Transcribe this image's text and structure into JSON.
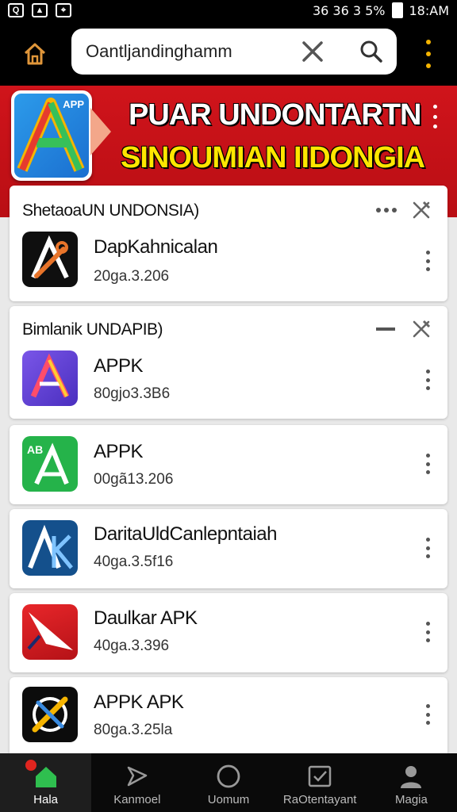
{
  "status_bar": {
    "left_icons": [
      "photo-icon",
      "image-icon",
      "app-icon"
    ],
    "right_text": "36  36 3 5%",
    "time": "18:AM"
  },
  "top_bar": {
    "search_value": "Oantljandinghamm"
  },
  "banner": {
    "logo_label": "APP",
    "title_line1": "PUAR UNDONTARTN",
    "title_line2": "SINOUMIAN IIDONGIA",
    "colors": {
      "background": "#c8121a",
      "line1": "#ffffff",
      "line2": "#ffe600"
    }
  },
  "sections": [
    {
      "title": "ShetaoaUN UNDONSIA)",
      "items": [
        {
          "name": "DapKahnicalan",
          "meta": "20ga.3.206",
          "icon": "black-a-tools-icon"
        }
      ]
    },
    {
      "title": "Bimlanik UNDAPIB)",
      "items": [
        {
          "name": "APPK",
          "meta": "80gjo3.3B6",
          "icon": "purple-a-logo-icon"
        }
      ]
    }
  ],
  "apps": [
    {
      "name": "APPK",
      "meta": "00gã13.206",
      "icon": "green-ab-logo-icon"
    },
    {
      "name": "DaritaUldCanlepntaiah",
      "meta": "40ga.3.5f16",
      "icon": "blue-ak-logo-icon"
    },
    {
      "name": "Daulkar APK",
      "meta": "40ga.3.396",
      "icon": "red-arrow-logo-icon"
    },
    {
      "name": "APPK APK",
      "meta": "80ga.3.25la",
      "icon": "black-wrench-logo-icon"
    }
  ],
  "bottom_nav": [
    {
      "label": "Hala",
      "icon": "home-icon",
      "active": true
    },
    {
      "label": "Kanmoel",
      "icon": "send-icon",
      "active": false
    },
    {
      "label": "Uomum",
      "icon": "circle-icon",
      "active": false
    },
    {
      "label": "RaOtentayant",
      "icon": "checkbox-icon",
      "active": false
    },
    {
      "label": "Magia",
      "icon": "profile-icon",
      "active": false
    }
  ]
}
